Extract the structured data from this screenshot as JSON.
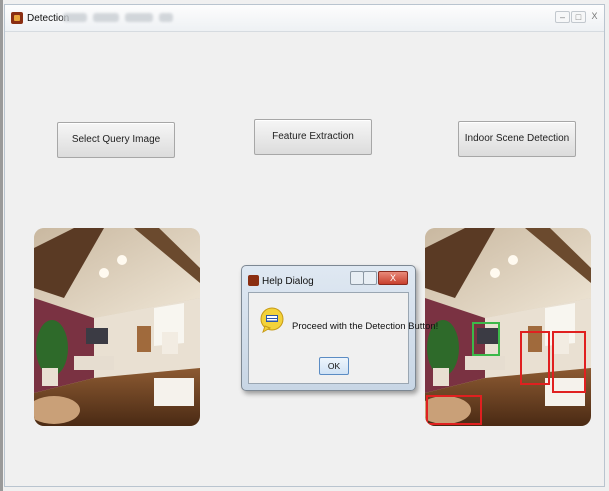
{
  "window": {
    "title": "Detection",
    "controls": {
      "minimize": "–",
      "maximize": "□",
      "close": "X"
    }
  },
  "buttons": {
    "select_query": "Select Query Image",
    "feature_extraction": "Feature Extraction",
    "indoor_detection": "Indoor Scene Detection"
  },
  "dialog": {
    "title": "Help Dialog",
    "message": "Proceed with the Detection Button!",
    "ok_label": "OK",
    "close_label": "X"
  },
  "colors": {
    "detection_box_red": "#e02020",
    "detection_box_green": "#3cb84a",
    "wall_accent": "#7a3242"
  }
}
